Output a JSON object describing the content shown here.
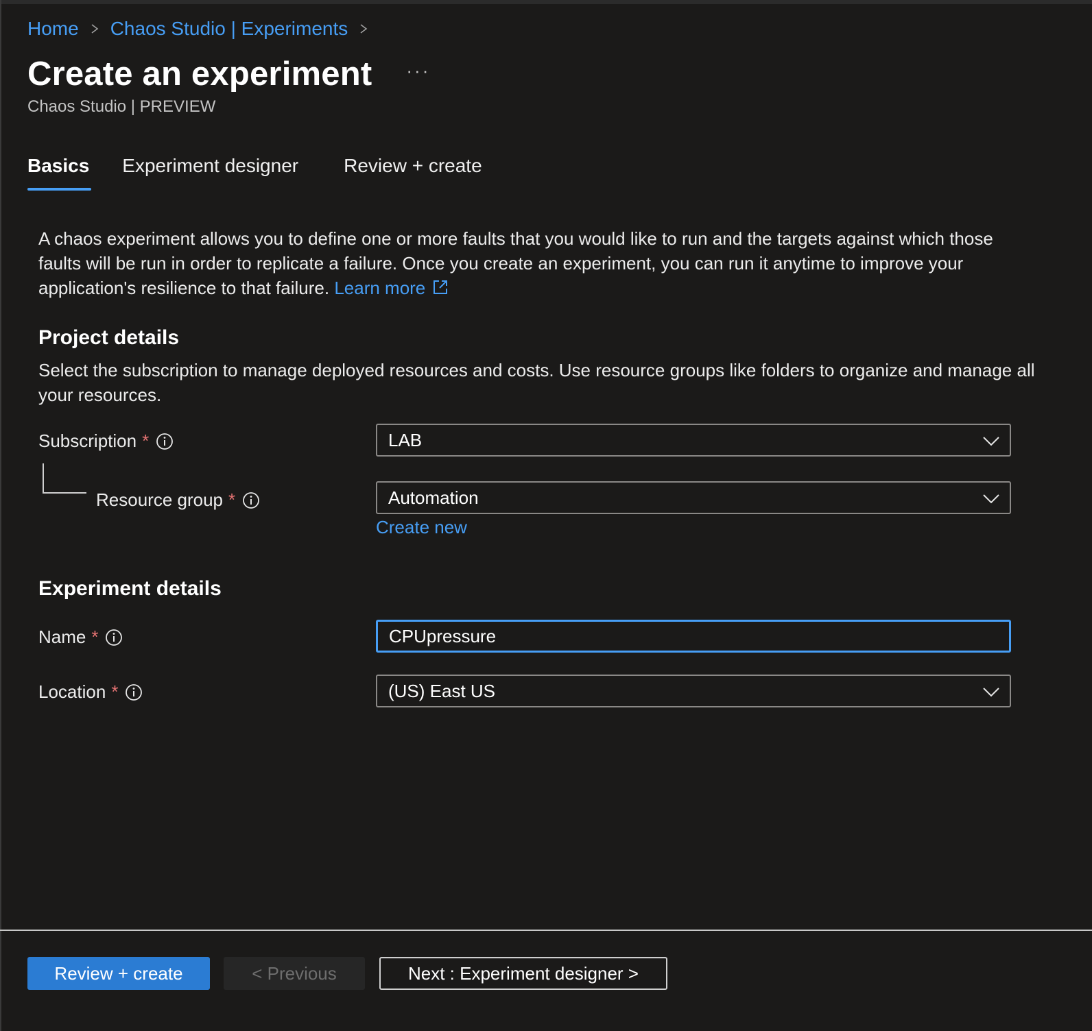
{
  "breadcrumb": {
    "items": [
      "Home",
      "Chaos Studio | Experiments"
    ]
  },
  "header": {
    "title": "Create an experiment",
    "more": "···",
    "subtitle": "Chaos Studio | PREVIEW"
  },
  "tabs": [
    {
      "label": "Basics",
      "active": true
    },
    {
      "label": "Experiment designer",
      "active": false
    },
    {
      "label": "Review + create",
      "active": false
    }
  ],
  "intro": {
    "text": "A chaos experiment allows you to define one or more faults that you would like to run and the targets against which those faults will be run in order to replicate a failure. Once you create an experiment, you can run it anytime to improve your application's resilience to that failure. ",
    "learn_more": "Learn more"
  },
  "project_details": {
    "heading": "Project details",
    "description": "Select the subscription to manage deployed resources and costs. Use resource groups like folders to organize and manage all your resources.",
    "subscription": {
      "label": "Subscription",
      "required": "*",
      "value": "LAB"
    },
    "resource_group": {
      "label": "Resource group",
      "required": "*",
      "value": "Automation",
      "create_new": "Create new"
    }
  },
  "experiment_details": {
    "heading": "Experiment details",
    "name": {
      "label": "Name",
      "required": "*",
      "value": "CPUpressure"
    },
    "location": {
      "label": "Location",
      "required": "*",
      "value": "(US) East US"
    }
  },
  "footer": {
    "review_create": "Review + create",
    "previous": "< Previous",
    "next": "Next : Experiment designer >"
  },
  "colors": {
    "background": "#1b1a19",
    "accent": "#479ef5",
    "primary_button": "#2b7cd3",
    "required": "#e57373"
  },
  "icons": {
    "breadcrumb_separator": "chevron-right-icon",
    "more": "more-icon",
    "external_link": "external-link-icon",
    "info": "info-icon",
    "dropdown": "chevron-down-icon"
  }
}
